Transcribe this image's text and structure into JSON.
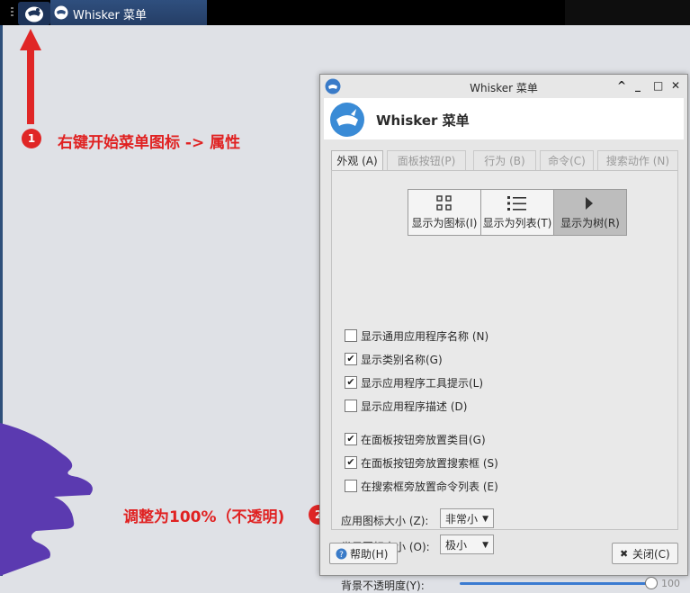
{
  "panel": {
    "task_title": "Whisker 菜单"
  },
  "annotations": {
    "step1_num": "1",
    "step1_text": "右键开始菜单图标 -> 属性",
    "step2_num": "2",
    "step2_text": "调整为100%（不透明)"
  },
  "window": {
    "title": "Whisker 菜单",
    "header_title": "Whisker 菜单",
    "controls": [
      "^",
      "_",
      "□",
      "✕"
    ],
    "tabs": [
      "外观 (A)",
      "面板按钮(P)",
      "行为 (B)",
      "命令(C)",
      "搜索动作 (N)"
    ],
    "active_tab": 0,
    "view_buttons": [
      {
        "label": "显示为图标(I)",
        "icon": "grid-icon",
        "selected": false
      },
      {
        "label": "显示为列表(T)",
        "icon": "list-icon",
        "selected": false
      },
      {
        "label": "显示为树(R)",
        "icon": "tree-arrow-icon",
        "selected": true
      }
    ],
    "checkboxes": [
      {
        "label": "显示通用应用程序名称 (N)",
        "checked": false
      },
      {
        "label": "显示类别名称(G)",
        "checked": true
      },
      {
        "label": "显示应用程序工具提示(L)",
        "checked": true
      },
      {
        "label": "显示应用程序描述 (D)",
        "checked": false
      },
      {
        "label": "在面板按钮旁放置类目(G)",
        "checked": true
      },
      {
        "label": "在面板按钮旁放置搜索框 (S)",
        "checked": true
      },
      {
        "label": "在搜索框旁放置命令列表 (E)",
        "checked": false
      }
    ],
    "app_icon_size_label": "应用图标大小 (Z):",
    "app_icon_size_value": "非常小",
    "cat_icon_size_label": "类目图标大小 (O):",
    "cat_icon_size_value": "极小",
    "opacity_label": "背景不透明度(Y):",
    "opacity_value": "100",
    "help_label": "帮助(H)",
    "close_label": "关闭(C)"
  },
  "colors": {
    "accent": "#3b7bd1",
    "annotation": "#e02222"
  }
}
